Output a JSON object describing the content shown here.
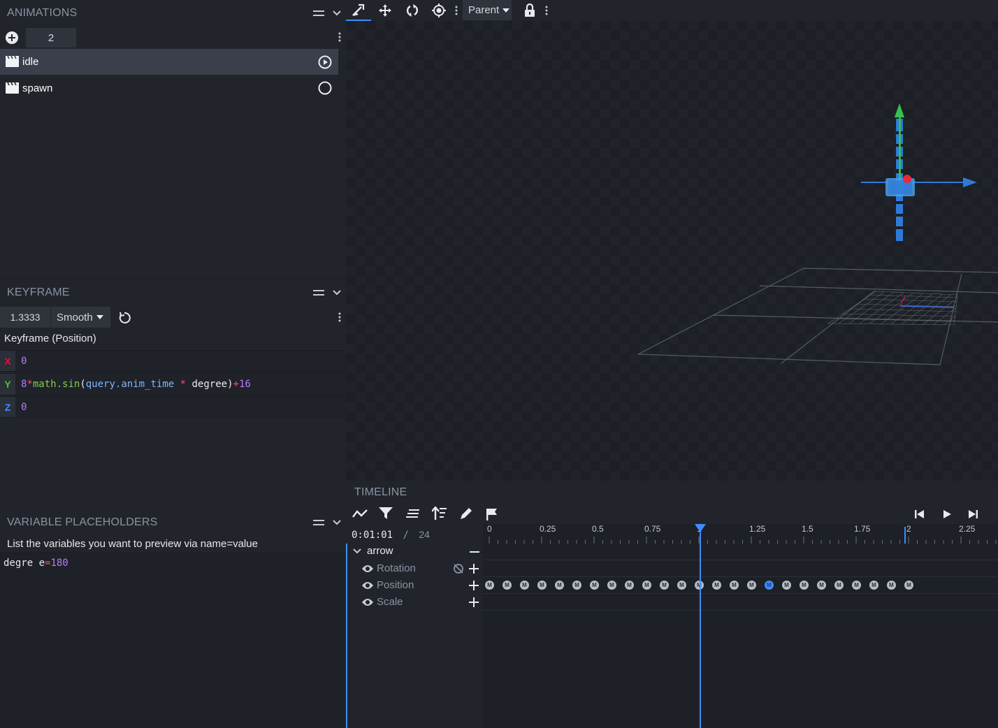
{
  "animations_panel": {
    "title": "ANIMATIONS",
    "count": "2",
    "items": [
      {
        "label": "idle",
        "selected": true
      },
      {
        "label": "spawn",
        "selected": false
      }
    ]
  },
  "keyframe_panel": {
    "title": "KEYFRAME",
    "time_value": "1.3333",
    "interpolation": "Smooth",
    "heading": "Keyframe (Position)",
    "rows": [
      {
        "axis": "X",
        "color": "#e0143c",
        "value": "0"
      },
      {
        "axis": "Y",
        "color": "#4ec42c",
        "value": "8*math.sin(query.anim_time * degree)+16"
      },
      {
        "axis": "Z",
        "color": "#3f8cff",
        "value": "0"
      }
    ]
  },
  "variables_panel": {
    "title": "VARIABLE PLACEHOLDERS",
    "description": "List the variables you want to preview via name=value",
    "content_name": "degre e",
    "content_op": "=",
    "content_value": "180"
  },
  "toolbar": {
    "space_select": "Parent"
  },
  "timeline": {
    "title": "TIMELINE",
    "timecode": "0:01:01",
    "separator": "/",
    "fps": "24",
    "ruler_labels": [
      "0",
      "0.25",
      "0.5",
      "0.75",
      "1",
      "1.25",
      "1.5",
      "1.75",
      "2",
      "2.25"
    ],
    "group": "arrow",
    "channels": [
      "Rotation",
      "Position",
      "Scale"
    ],
    "keyframe_glyph": "M",
    "playhead_time": 1.0
  },
  "colors": {
    "accent": "#3f8cff",
    "x_axis": "#e0143c",
    "y_axis": "#4ec42c",
    "z_axis": "#3f8cff"
  }
}
